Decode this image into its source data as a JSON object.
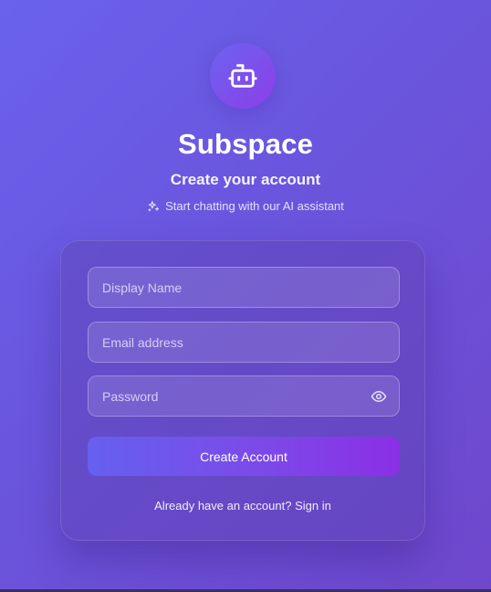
{
  "app": {
    "title": "Subspace",
    "subtitle": "Create your account",
    "tagline": "Start chatting with our AI assistant",
    "logo_icon": "robot-icon",
    "tagline_icon": "sparkles-icon"
  },
  "form": {
    "display_name": {
      "value": "",
      "placeholder": "Display Name"
    },
    "email": {
      "value": "",
      "placeholder": "Email address"
    },
    "password": {
      "value": "",
      "placeholder": "Password",
      "toggle_icon": "eye-icon"
    },
    "submit_label": "Create Account"
  },
  "footer": {
    "prompt": "Already have an account?",
    "link_label": "Sign in"
  },
  "colors": {
    "background_start": "#6a62ec",
    "background_end": "#6f47cc",
    "button_start": "#6560f0",
    "button_end": "#8b2fe6"
  }
}
